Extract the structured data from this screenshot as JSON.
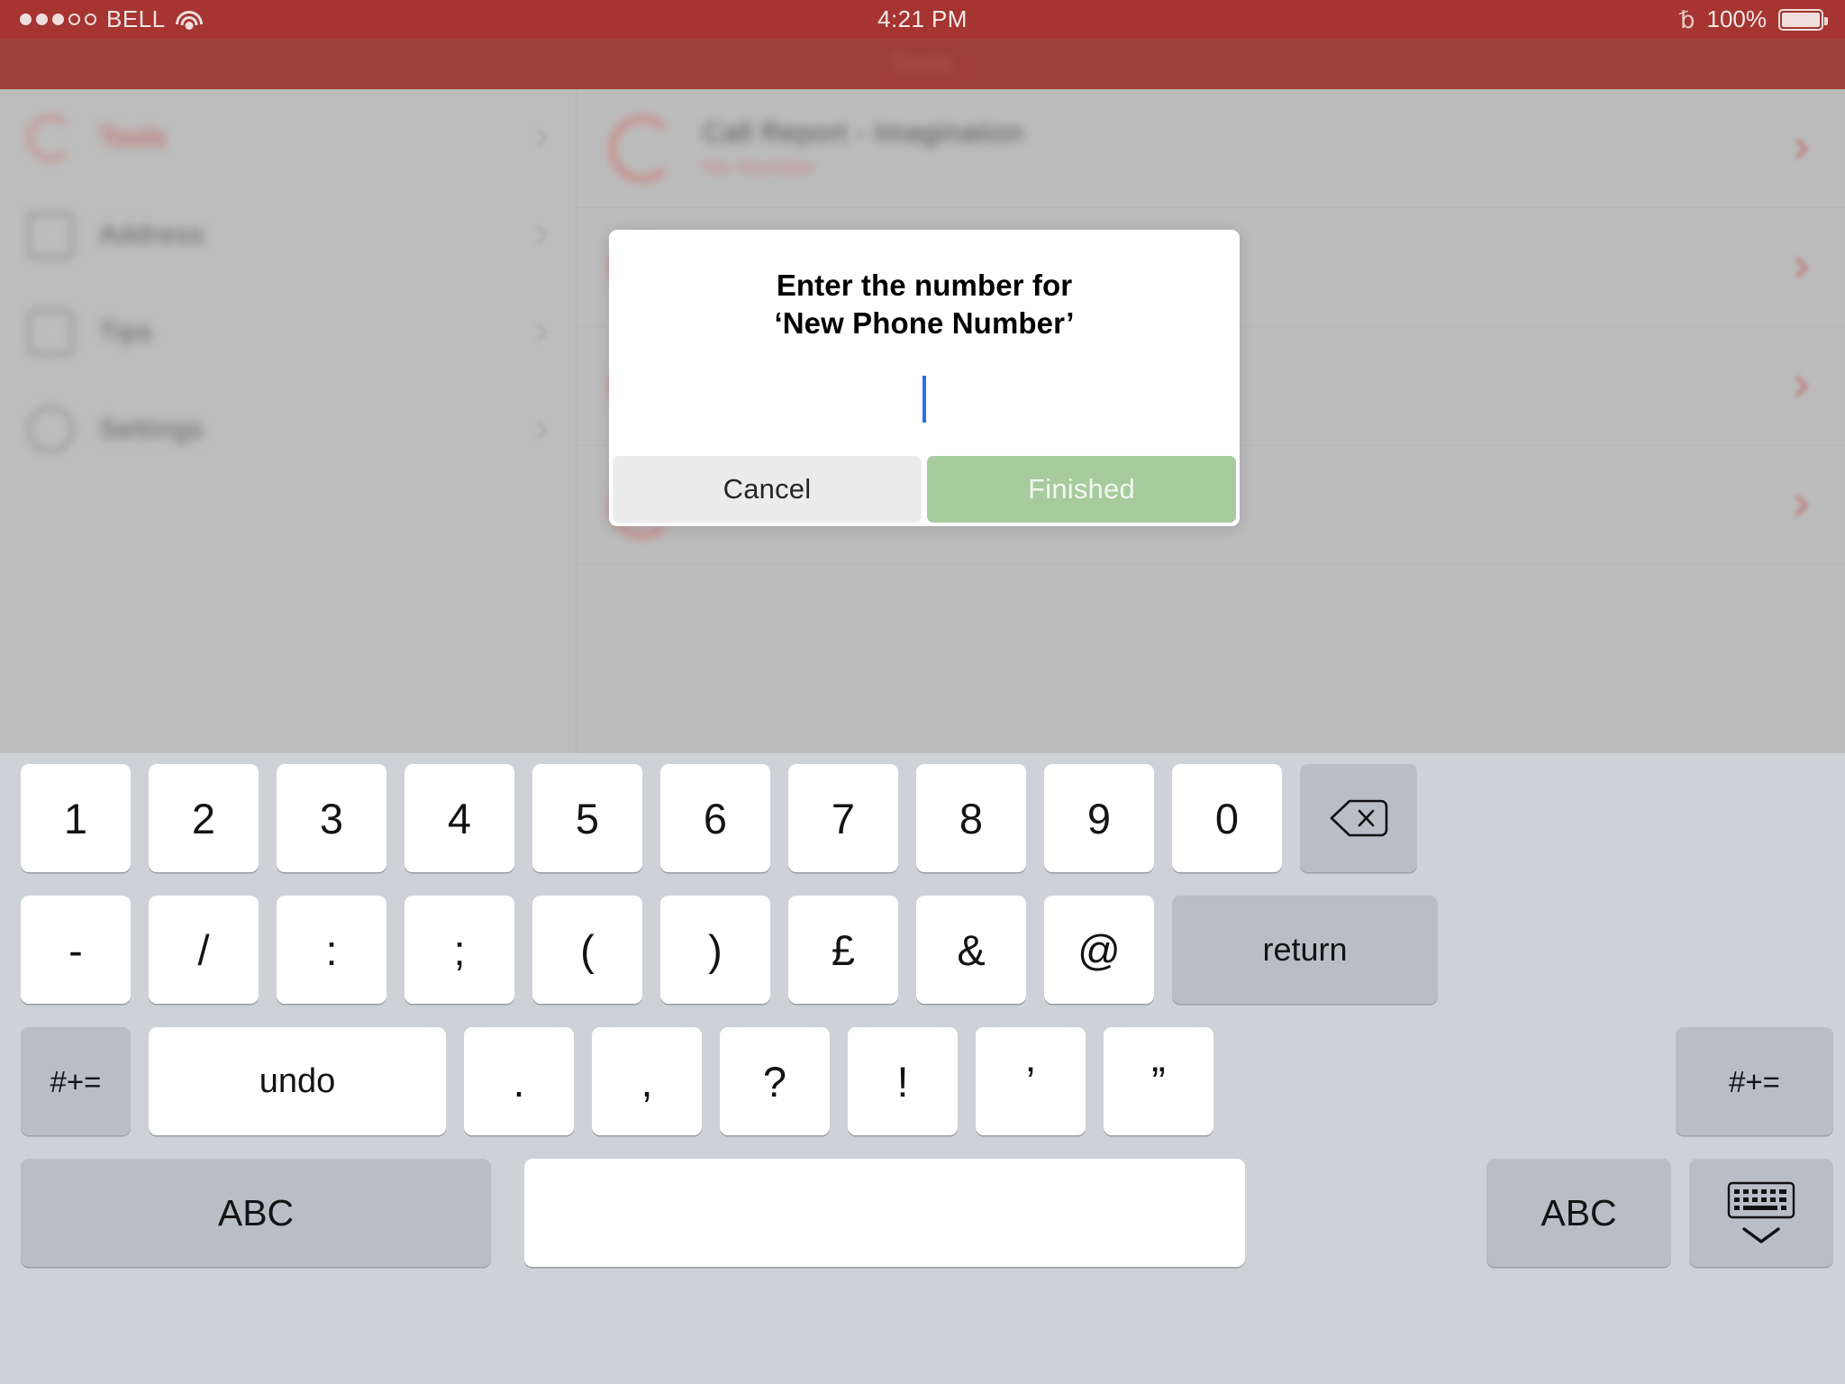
{
  "status_bar": {
    "carrier": "BELL",
    "signal_dots_filled": 3,
    "signal_dots_total": 5,
    "wifi_icon": "wifi-icon",
    "time": "4:21 PM",
    "bluetooth_icon": "bluetooth-icon",
    "battery_percent": "100%",
    "battery_icon": "battery-full-icon",
    "background_color": "#a63430"
  },
  "navbar": {
    "title": "Tools",
    "background_color": "#a63430"
  },
  "sidebar": {
    "items": [
      {
        "label": "Tools",
        "icon": "phone-ring-icon",
        "chevron": "chevron-right-icon"
      },
      {
        "label": "Address",
        "icon": "address-book-icon",
        "chevron": "chevron-right-icon"
      },
      {
        "label": "Tips",
        "icon": "info-icon",
        "chevron": "chevron-right-icon"
      },
      {
        "label": "Settings",
        "icon": "gear-icon",
        "chevron": "chevron-right-icon"
      }
    ]
  },
  "content": {
    "rows": [
      {
        "title": "Call Report  -  Imagination",
        "subtitle": "No Number",
        "avatar": "call-avatar-icon",
        "chevron": "chevron-right-icon"
      },
      {
        "title": "",
        "subtitle": "",
        "avatar": "call-avatar-icon",
        "chevron": "chevron-right-icon"
      },
      {
        "title": "",
        "subtitle": "",
        "avatar": "call-avatar-icon",
        "chevron": "chevron-right-icon"
      },
      {
        "title": "",
        "subtitle": "",
        "avatar": "call-avatar-icon",
        "chevron": "chevron-right-icon"
      }
    ]
  },
  "alert": {
    "title": "Enter the number for\n‘New Phone Number’",
    "input_value": "",
    "input_placeholder": "",
    "cancel_label": "Cancel",
    "confirm_label": "Finished",
    "confirm_color": "#a6cb9c",
    "caret_color": "#2a6df0"
  },
  "keyboard": {
    "background_color": "#ced2d7",
    "row1": [
      {
        "label": "1",
        "type": "light"
      },
      {
        "label": "2",
        "type": "light"
      },
      {
        "label": "3",
        "type": "light"
      },
      {
        "label": "4",
        "type": "light"
      },
      {
        "label": "5",
        "type": "light"
      },
      {
        "label": "6",
        "type": "light"
      },
      {
        "label": "7",
        "type": "light"
      },
      {
        "label": "8",
        "type": "light"
      },
      {
        "label": "9",
        "type": "light"
      },
      {
        "label": "0",
        "type": "light"
      }
    ],
    "backspace_icon": "backspace-icon",
    "row2": [
      {
        "label": "-",
        "type": "light"
      },
      {
        "label": "/",
        "type": "light"
      },
      {
        "label": ":",
        "type": "light"
      },
      {
        "label": ";",
        "type": "light"
      },
      {
        "label": "(",
        "type": "light"
      },
      {
        "label": ")",
        "type": "light"
      },
      {
        "label": "£",
        "type": "light"
      },
      {
        "label": "&",
        "type": "light"
      },
      {
        "label": "@",
        "type": "light"
      }
    ],
    "return_label": "return",
    "row3": {
      "symbols_left_label": "#+=",
      "undo_label": "undo",
      "keys": [
        {
          "label": ".",
          "type": "light"
        },
        {
          "label": ",",
          "type": "light"
        },
        {
          "label": "?",
          "type": "light"
        },
        {
          "label": "!",
          "type": "light"
        },
        {
          "label": "’",
          "type": "light"
        },
        {
          "label": "”",
          "type": "light"
        }
      ],
      "symbols_right_label": "#+="
    },
    "row4": {
      "abc_left_label": "ABC",
      "space_label": "",
      "abc_right_label": "ABC",
      "hide_keyboard_icon": "hide-keyboard-icon"
    }
  }
}
